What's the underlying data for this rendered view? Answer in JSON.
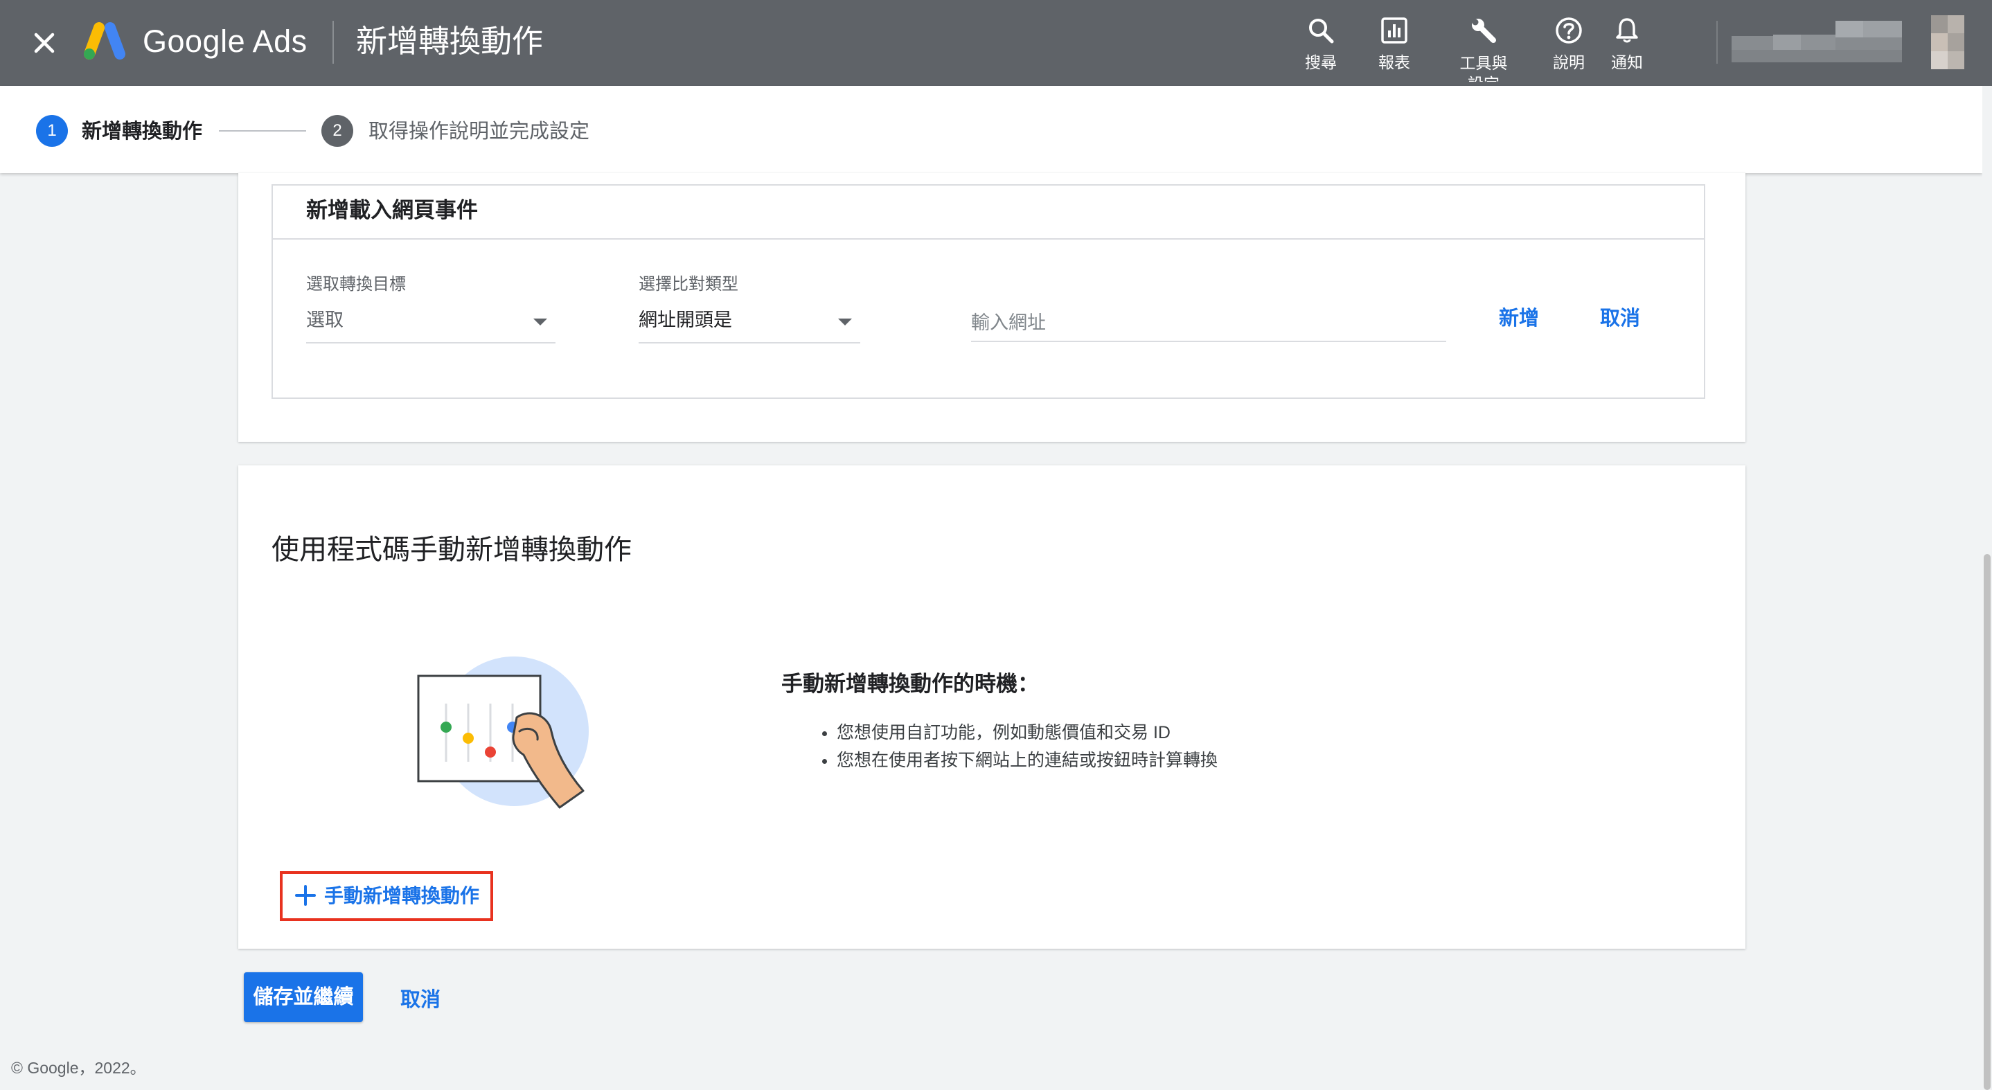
{
  "app": {
    "brand": "Google Ads",
    "page_title": "新增轉換動作"
  },
  "toolbar": {
    "search_label": "搜尋",
    "reports_label": "報表",
    "tools_label": "工具與設定",
    "help_label": "說明",
    "notifications_label": "通知"
  },
  "stepper": {
    "steps": [
      {
        "number": "1",
        "label": "新增轉換動作",
        "state": "active"
      },
      {
        "number": "2",
        "label": "取得操作說明並完成設定",
        "state": "pending"
      }
    ]
  },
  "page_load_event": {
    "title": "新增載入網頁事件",
    "goal": {
      "label": "選取轉換目標",
      "value": "選取"
    },
    "match_type": {
      "label": "選擇比對類型",
      "value": "網址開頭是"
    },
    "url": {
      "placeholder": "輸入網址",
      "value": ""
    },
    "add_label": "新增",
    "cancel_label": "取消"
  },
  "manual_section": {
    "title": "使用程式碼手動新增轉換動作",
    "when_heading": "手動新增轉換動作的時機：",
    "bullets": [
      "您想使用自訂功能，例如動態價值和交易 ID",
      "您想在使用者按下網站上的連結或按鈕時計算轉換"
    ],
    "manual_add_label": "手動新增轉換動作"
  },
  "footer": {
    "save_label": "儲存並繼續",
    "cancel_label": "取消",
    "copyright": "© Google，2022。"
  },
  "colors": {
    "topbar": "#5f6368",
    "accent": "#1a73e8",
    "highlight_border": "#e8321f",
    "background": "#f1f3f4"
  },
  "icons": {
    "close": "close-icon",
    "logo": "google-ads-logo",
    "search": "search-icon",
    "reports": "bar-chart-icon",
    "tools": "wrench-icon",
    "help": "help-circle-icon",
    "notifications": "bell-icon",
    "add": "plus-icon",
    "dropdown": "caret-down-icon"
  }
}
